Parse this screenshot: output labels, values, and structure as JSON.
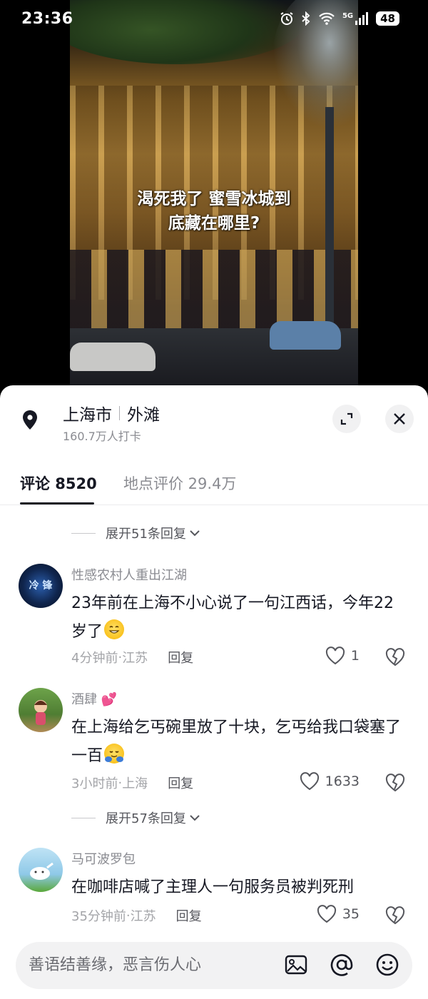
{
  "status_bar": {
    "time": "23:36",
    "network": "5G",
    "battery": "48",
    "icons": [
      "alarm-icon",
      "bluetooth-icon",
      "wifi-icon",
      "signal-icon",
      "battery-icon"
    ]
  },
  "video": {
    "caption_line1": "渴死我了 蜜雪冰城到",
    "caption_line2": "底藏在哪里?"
  },
  "location": {
    "city": "上海市",
    "place": "外滩",
    "checkins": "160.7万人打卡"
  },
  "tabs": [
    {
      "label": "评论 8520",
      "active": true
    },
    {
      "label": "地点评价 29.4万",
      "active": false
    }
  ],
  "expand_replies": [
    {
      "label": "展开51条回复"
    },
    {
      "label": "展开57条回复"
    }
  ],
  "comments": [
    {
      "user": "性感农村人重出江湖",
      "avatar_text": "冷 锋",
      "text": "23年前在上海不小心说了一句江西话，今年22岁了",
      "emoji": "grinning-emoji",
      "time": "4分钟前",
      "region": "江苏",
      "reply": "回复",
      "likes": "1"
    },
    {
      "user": "酒肆",
      "user_badge": "hearts-emoji",
      "text": "在上海给乞丐碗里放了十块，乞丐给我口袋塞了一百",
      "emoji": "hug-emoji",
      "time": "3小时前",
      "region": "上海",
      "reply": "回复",
      "likes": "1633"
    },
    {
      "user": "马可波罗包",
      "text": "在咖啡店喊了主理人一句服务员被判死刑",
      "time": "35分钟前",
      "region": "江苏",
      "reply": "回复",
      "likes": "35"
    }
  ],
  "meta_separator": " · ",
  "input": {
    "placeholder": "善语结善缘，恶言伤人心"
  },
  "colors": {
    "text_primary": "#161823",
    "text_secondary": "#8a8b91",
    "sheet_bg": "#ffffff",
    "input_bg": "#f2f2f3"
  }
}
